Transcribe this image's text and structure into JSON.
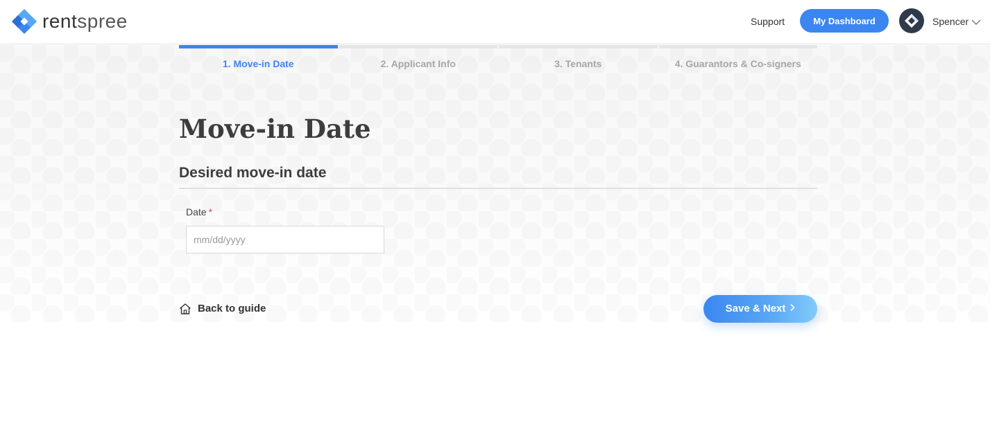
{
  "header": {
    "brand_rent": "rent",
    "brand_spree": "spree",
    "support_label": "Support",
    "dashboard_label": "My Dashboard",
    "user_name": "Spencer"
  },
  "stepper": {
    "steps": [
      {
        "label": "1. Move-in Date",
        "active": true
      },
      {
        "label": "2. Applicant Info",
        "active": false
      },
      {
        "label": "3. Tenants",
        "active": false
      },
      {
        "label": "4. Guarantors & Co-signers",
        "active": false
      }
    ]
  },
  "main": {
    "title": "Move-in Date",
    "section_title": "Desired move-in date",
    "date_field": {
      "label": "Date",
      "required_mark": "*",
      "placeholder": "mm/dd/yyyy",
      "value": ""
    }
  },
  "footer": {
    "back_label": "Back to guide",
    "save_label": "Save & Next"
  },
  "colors": {
    "accent": "#3b86f0",
    "required": "#e2434b",
    "inactive_step": "#a6a6a6"
  },
  "icons": {
    "logo": "rentspree-logo-icon",
    "avatar": "user-avatar-icon",
    "chevron": "chevron-down-icon",
    "home": "home-icon",
    "next": "chevron-right-icon"
  }
}
